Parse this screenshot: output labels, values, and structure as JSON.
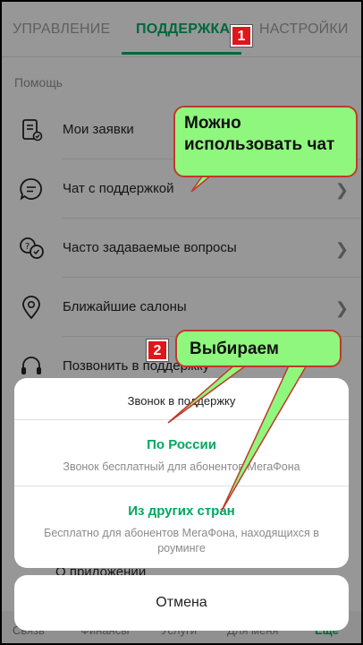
{
  "tabs": {
    "management": "УПРАВЛЕНИЕ",
    "support": "ПОДДЕРЖКА",
    "settings": "НАСТРОЙКИ",
    "active": "support"
  },
  "section_label": "Помощь",
  "items": [
    {
      "label": "Мои заявки",
      "icon": "document-icon"
    },
    {
      "label": "Чат с поддержкой",
      "icon": "chat-icon"
    },
    {
      "label": "Часто задаваемые вопросы",
      "icon": "faq-icon"
    },
    {
      "label": "Ближайшие салоны",
      "icon": "location-pin-icon"
    },
    {
      "label": "Позвонить в поддержку",
      "icon": "headset-icon"
    }
  ],
  "about_label": "О приложении",
  "bottom_nav": [
    "Связь",
    "Финансы",
    "Услуги",
    "Для меня",
    "Ещё"
  ],
  "sheet": {
    "title": "Звонок в поддержку",
    "options": [
      {
        "title": "По России",
        "subtitle": "Звонок бесплатный для абонентов МегаФона"
      },
      {
        "title": "Из других стран",
        "subtitle": "Бесплатно для абонентов МегаФона, находящихся в роуминге"
      }
    ],
    "cancel_label": "Отмена"
  },
  "annotations": {
    "badge1": "1",
    "badge2": "2",
    "bubble1": "Можно использовать чат",
    "bubble2": "Выбираем"
  },
  "colors": {
    "accent": "#00a862",
    "bubble": "#8ff77e",
    "badge": "#e0161b"
  }
}
